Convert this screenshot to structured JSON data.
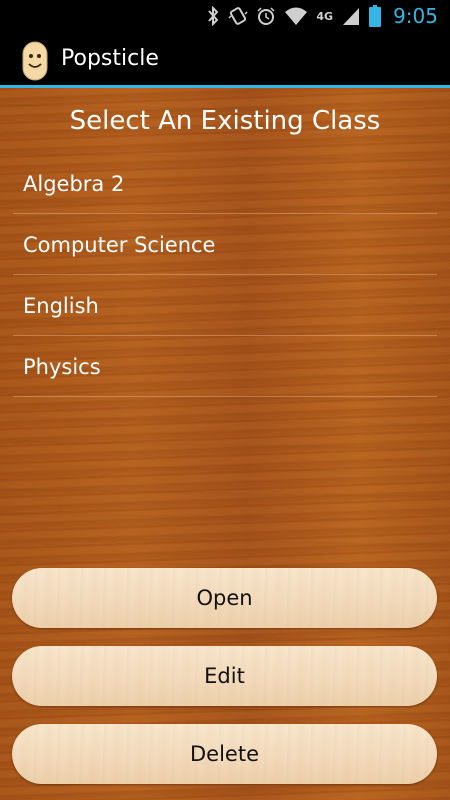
{
  "status_bar": {
    "time": "9:05",
    "network": "4G",
    "icons": [
      "bluetooth-icon",
      "vibrate-icon",
      "alarm-icon",
      "wifi-icon",
      "signal-icon",
      "battery-icon"
    ],
    "accent_color": "#33b5e5"
  },
  "action_bar": {
    "title": "Popsticle",
    "icon": "popsicle-face-icon"
  },
  "main": {
    "heading": "Select An Existing Class",
    "classes": [
      {
        "label": "Algebra 2"
      },
      {
        "label": "Computer Science"
      },
      {
        "label": "English"
      },
      {
        "label": "Physics"
      }
    ],
    "buttons": {
      "open_label": "Open",
      "edit_label": "Edit",
      "delete_label": "Delete"
    }
  }
}
